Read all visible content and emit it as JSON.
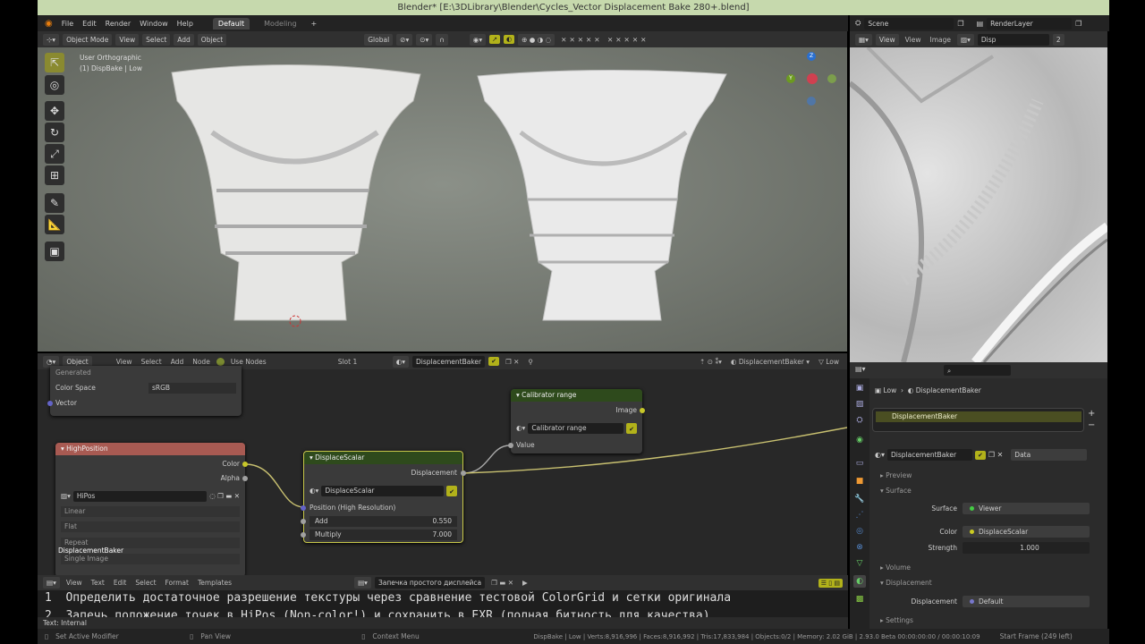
{
  "title": "Blender* [E:\\3DLibrary\\Blender\\Cycles_Vector Displacement Bake 280+.blend]",
  "menu": [
    "File",
    "Edit",
    "Render",
    "Window",
    "Help"
  ],
  "workspaces": [
    "Default",
    "Modeling"
  ],
  "viewport": {
    "mode": "Object Mode",
    "menus": [
      "View",
      "Select",
      "Add",
      "Object"
    ],
    "orientation": "Global",
    "overlay_line1": "User Orthographic",
    "overlay_line2": "(1) DispBake | Low",
    "gizmo": {
      "z": "Z",
      "y": "Y",
      "x": "X"
    }
  },
  "top_right": {
    "scene": "Scene",
    "view_layer": "RenderLayer"
  },
  "image_editor": {
    "view_mode": "View",
    "menus": [
      "View",
      "Image"
    ],
    "image": "Disp",
    "users": "2"
  },
  "node_editor": {
    "type": "Object",
    "menus": [
      "View",
      "Select",
      "Add",
      "Node"
    ],
    "use_nodes": "Use Nodes",
    "slot": "Slot 1",
    "material": "DisplacementBaker",
    "material_right": "DisplacementBaker",
    "object": "Low",
    "nodes": {
      "top_node": {
        "projection": "Generated",
        "color_space_label": "Color Space",
        "color_space": "sRGB",
        "vector": "Vector"
      },
      "high_position": {
        "title": "HighPosition",
        "out_color": "Color",
        "out_alpha": "Alpha",
        "image": "HiPos",
        "interpolation": "Linear",
        "projection": "Flat",
        "extension": "Repeat",
        "source": "Single Image",
        "frame_label": "DisplacementBaker"
      },
      "displace_scalar": {
        "title": "DisplaceScalar",
        "output": "Displacement",
        "group": "DisplaceScalar",
        "input": "Position (High Resolution)",
        "add_label": "Add",
        "add_value": "0.550",
        "mul_label": "Multiply",
        "mul_value": "7.000"
      },
      "calibrator": {
        "title": "Calibrator range",
        "output": "Image",
        "group": "Calibrator range",
        "input": "Value"
      }
    }
  },
  "properties": {
    "breadcrumb_object": "Low",
    "breadcrumb_material": "DisplacementBaker",
    "slot_material": "DisplacementBaker",
    "material": "DisplacementBaker",
    "link": "Data",
    "sections": {
      "preview": "Preview",
      "surface": "Surface",
      "volume": "Volume",
      "displacement": "Displacement",
      "settings": "Settings"
    },
    "surface_label": "Surface",
    "surface_value": "Viewer",
    "color_label": "Color",
    "color_value": "DisplaceScalar",
    "strength_label": "Strength",
    "strength_value": "1.000",
    "disp_label": "Displacement",
    "disp_value": "Default"
  },
  "text_editor": {
    "menus": [
      "View",
      "Text",
      "Edit",
      "Select",
      "Format",
      "Templates"
    ],
    "text_name": "Запечка простого дисплейса",
    "line1_num": "1",
    "line1": "Определить достаточное разрешение текстуры через сравнение тестовой ColorGrid и сетки оригинала",
    "line2_num": "2",
    "line2": "Запечь положение точек в HiPos (Non-color!) и сохранить в EXR (полная битность для качества)",
    "footer": "Text: Internal"
  },
  "status": {
    "hint1": "Set Active Modifier",
    "hint2": "Pan View",
    "hint3": "Context Menu",
    "stats": "DispBake | Low | Verts:8,916,996 | Faces:8,916,992 | Tris:17,833,984 | Objects:0/2 | Memory: 2.02 GiB | 2.93.0 Beta  00:00:00:00 / 00:00:10:09",
    "frame": "Start Frame (249 left)"
  }
}
